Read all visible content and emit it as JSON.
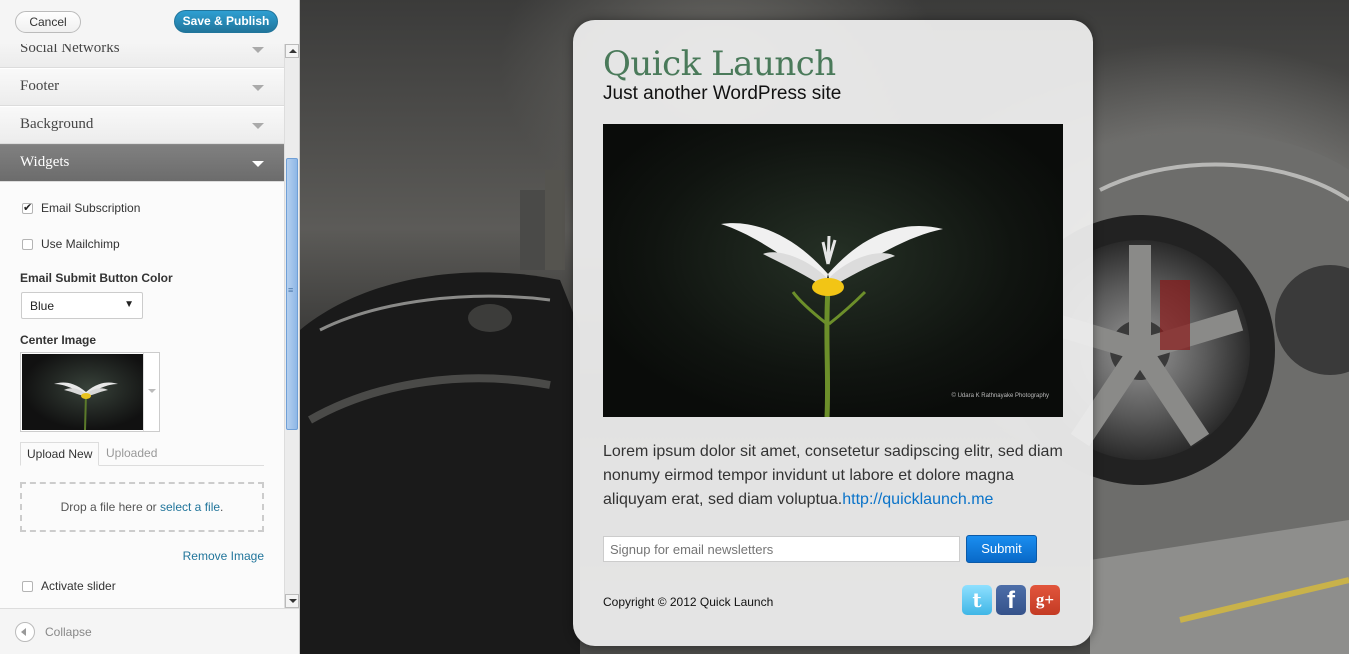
{
  "topbar": {
    "cancel_label": "Cancel",
    "publish_label": "Save & Publish"
  },
  "sections": [
    {
      "label": "Social Networks",
      "open": false
    },
    {
      "label": "Footer",
      "open": false
    },
    {
      "label": "Background",
      "open": false
    },
    {
      "label": "Widgets",
      "open": true
    }
  ],
  "widgets": {
    "email_subscription": {
      "label": "Email Subscription",
      "checked": true
    },
    "use_mailchimp": {
      "label": "Use Mailchimp",
      "checked": false
    },
    "button_color": {
      "title": "Email Submit Button Color",
      "selected": "Blue"
    },
    "center_image": {
      "title": "Center Image",
      "tab_upload": "Upload New",
      "tab_uploaded": "Uploaded",
      "drop_text": "Drop a file here or",
      "drop_link": "select a file",
      "drop_suffix": ".",
      "remove_label": "Remove Image"
    },
    "activate_slider": {
      "label": "Activate slider",
      "checked": false
    }
  },
  "collapse_label": "Collapse",
  "preview": {
    "site_title": "Quick Launch",
    "tagline": "Just another WordPress site",
    "hero_credit": "© Udara K Rathnayake Photography",
    "body_text": "Lorem ipsum dolor sit amet, consetetur sadipscing elitr, sed diam nonumy eirmod tempor invidunt ut labore et dolore magna aliquyam erat, sed diam voluptua.",
    "body_link": "http://quicklaunch.me",
    "email_placeholder": "Signup for email newsletters",
    "submit_label": "Submit",
    "copyright": "Copyright © 2012 Quick Launch",
    "social": {
      "twitter": "t",
      "facebook": "f",
      "gplus": "g+"
    },
    "colors": {
      "title": "#4a7a5a",
      "link": "#0a73c9",
      "submit": "#1a8ef0",
      "publish": "#21759b"
    }
  }
}
